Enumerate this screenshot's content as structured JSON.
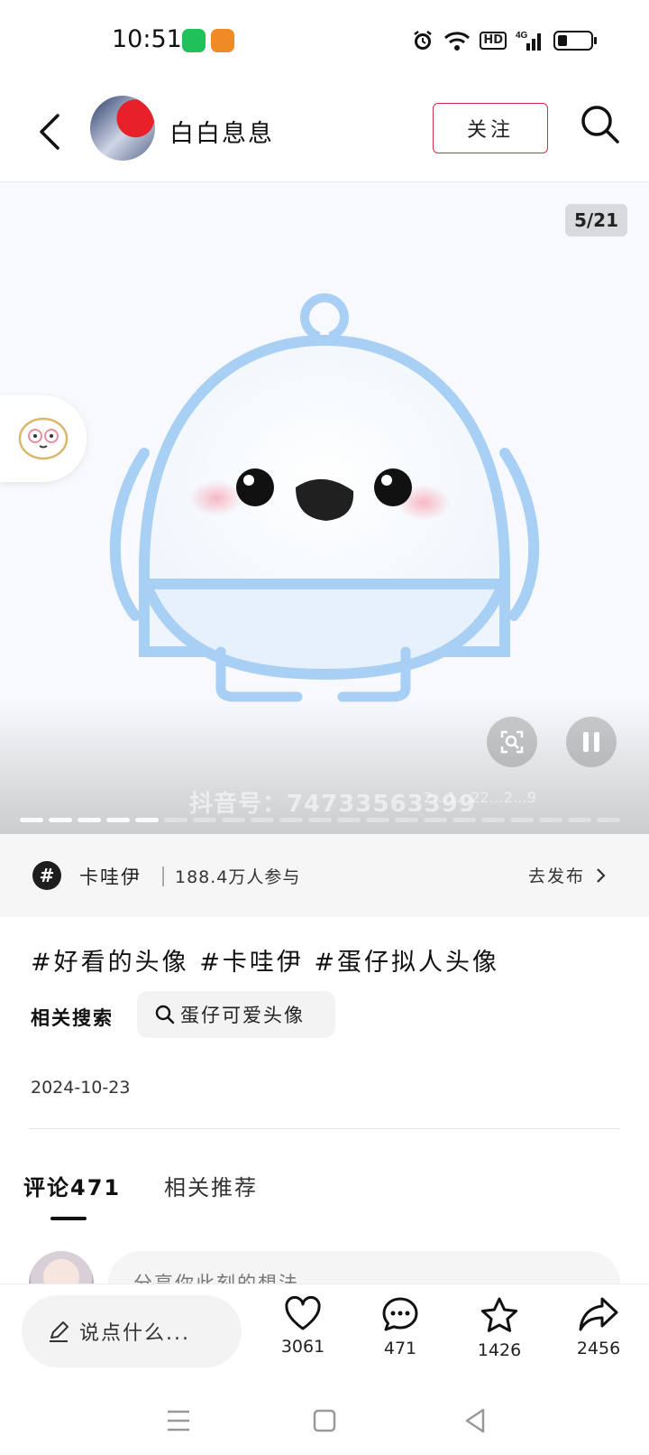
{
  "status_bar": {
    "time": "10:51",
    "network": "4G",
    "hd": "HD",
    "battery_level": 0.3
  },
  "header": {
    "author_name": "白白息息",
    "follow_label": "关注"
  },
  "media": {
    "counter": "5/21",
    "watermark": "抖音号：74733563399",
    "watermark_small": "2…1…22…2…9",
    "page_total": 21,
    "page_current": 5
  },
  "topic": {
    "name": "卡哇伊",
    "participants": "188.4万人参与",
    "action": "去发布"
  },
  "post": {
    "tags": "#好看的头像 #卡哇伊 #蛋仔拟人头像",
    "related_label": "相关搜索",
    "related_query": "蛋仔可爱头像",
    "date": "2024-10-23"
  },
  "tabs": {
    "comments": "评论471",
    "related": "相关推荐"
  },
  "comment_input": {
    "placeholder": "分享你此刻的想法"
  },
  "actions": {
    "say_label": "说点什么...",
    "likes": "3061",
    "comments": "471",
    "favorites": "1426",
    "shares": "2456"
  },
  "colors": {
    "accent": "#d4304a",
    "mascot_outline": "#a8d0f5"
  }
}
